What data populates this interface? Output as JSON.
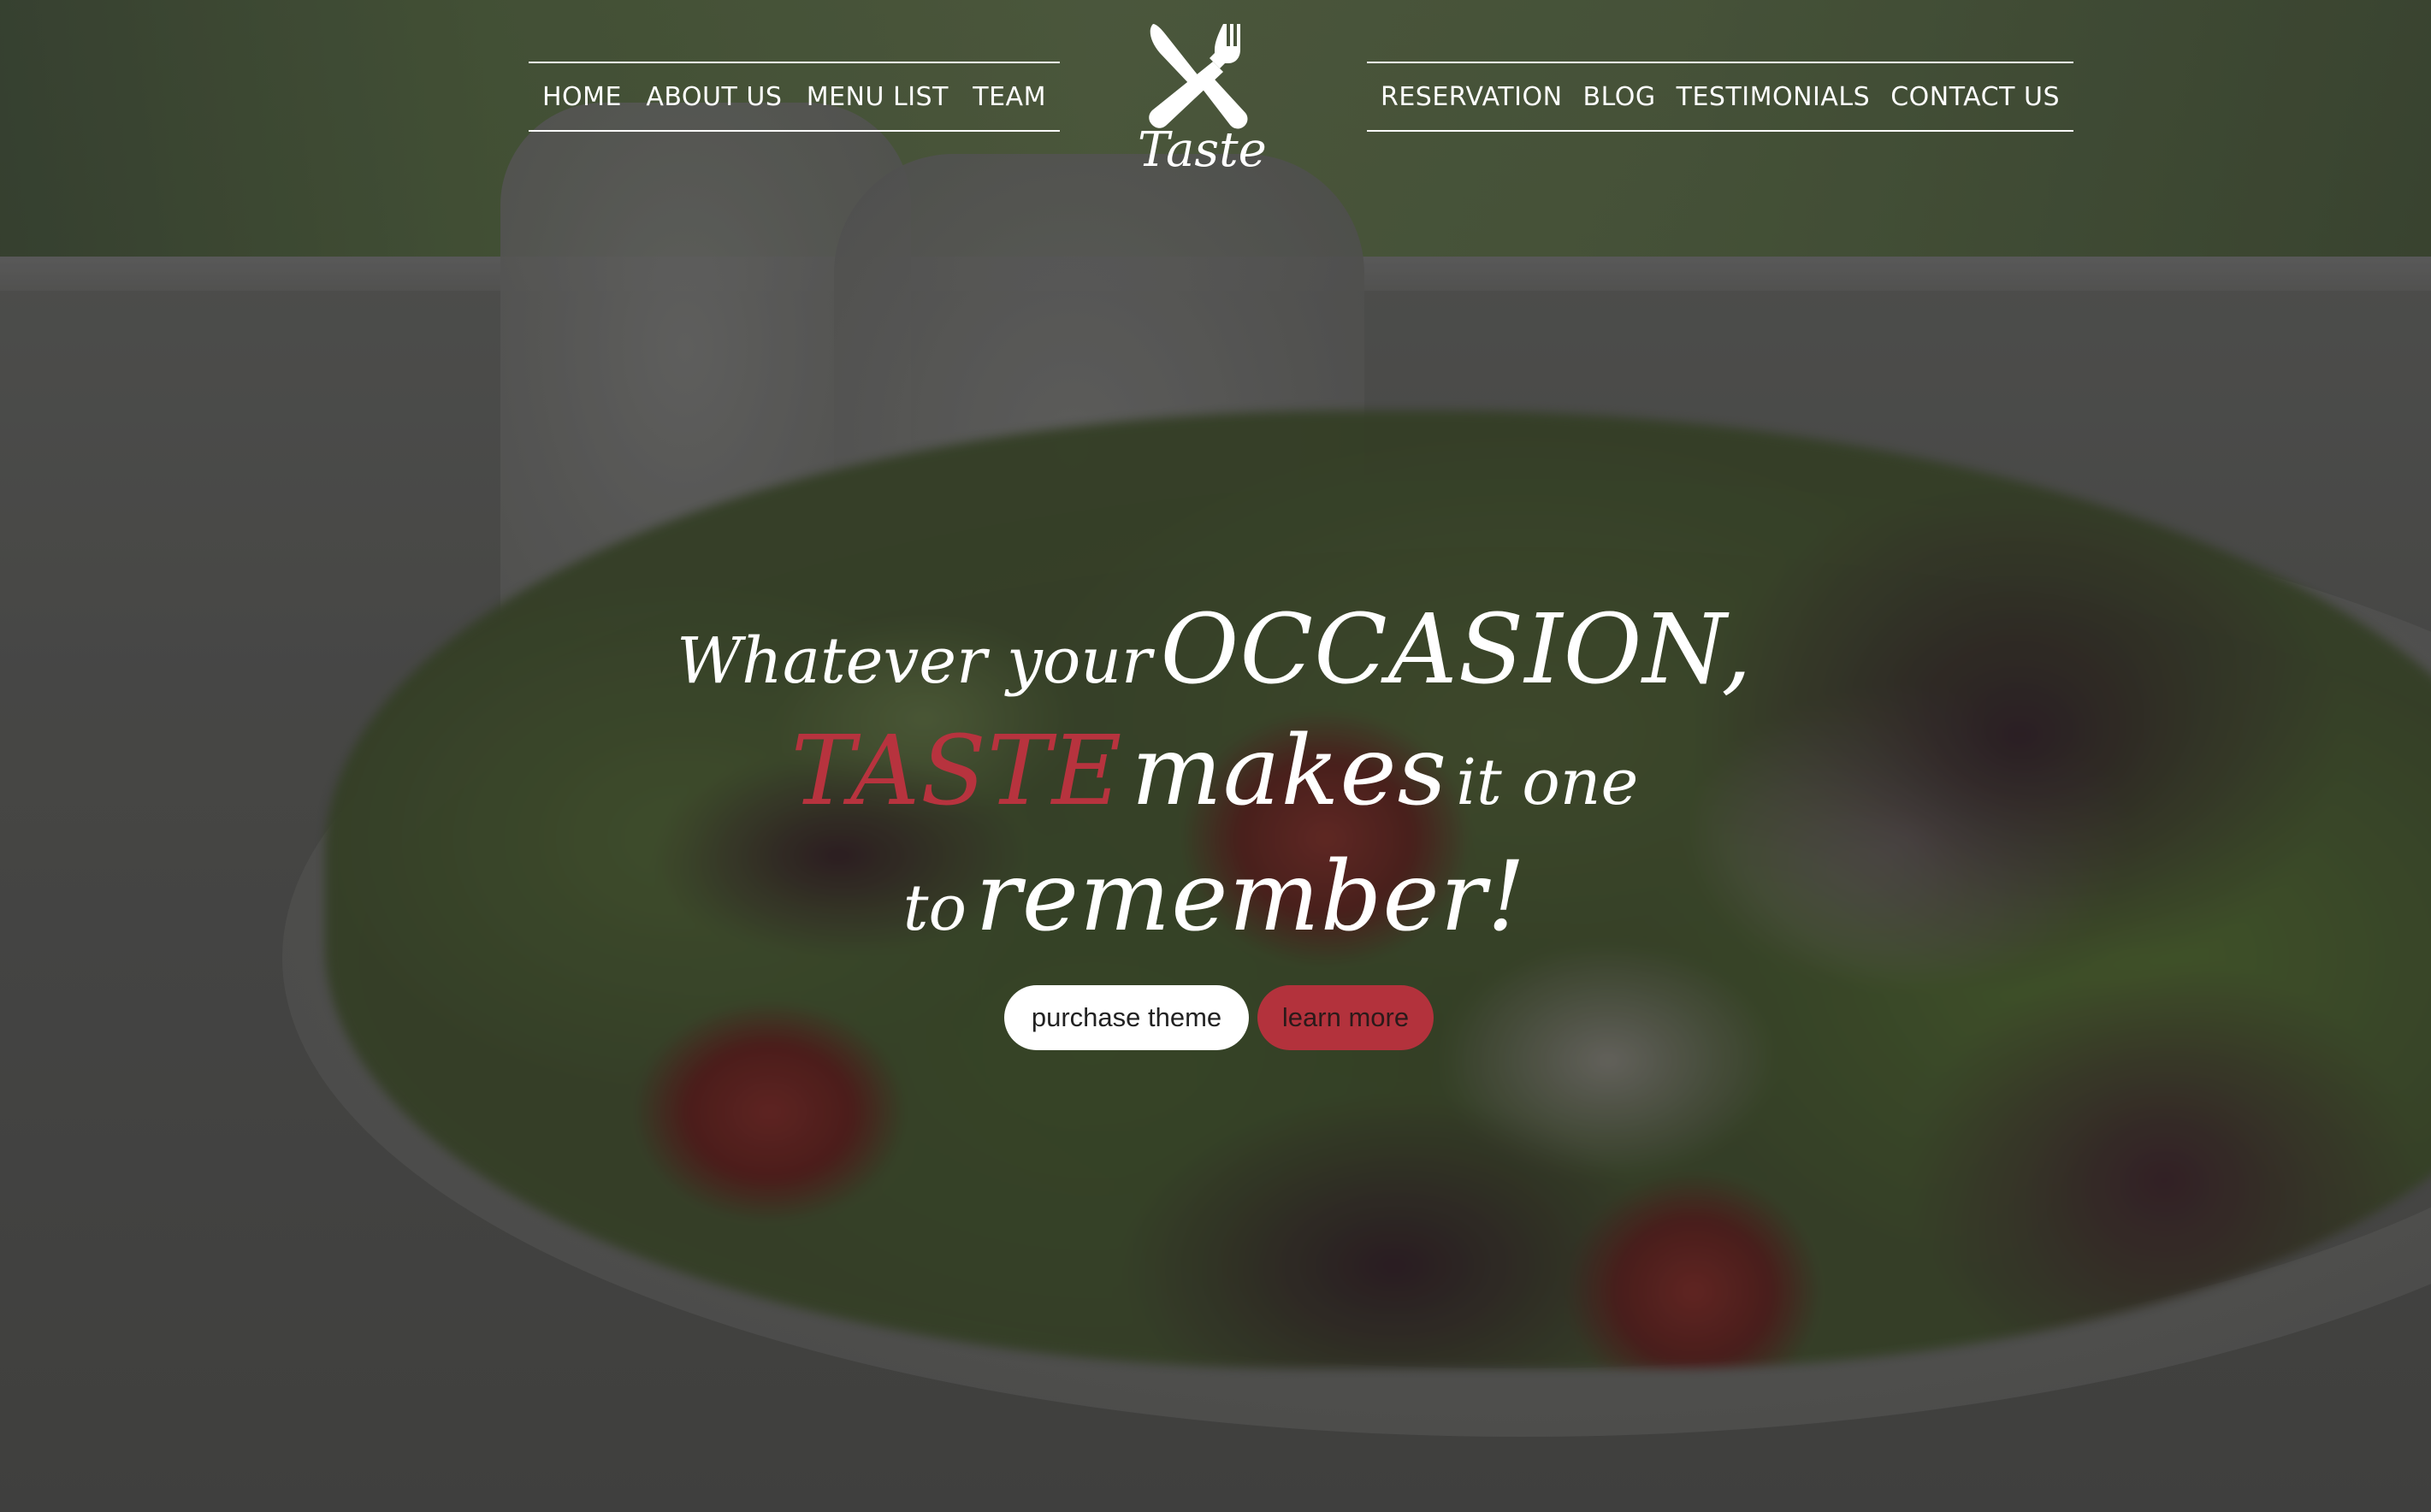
{
  "nav": {
    "left": [
      {
        "label": "HOME"
      },
      {
        "label": "ABOUT US"
      },
      {
        "label": "MENU LIST"
      },
      {
        "label": "TEAM"
      }
    ],
    "right": [
      {
        "label": "RESERVATION"
      },
      {
        "label": "BLOG"
      },
      {
        "label": "TESTIMONIALS"
      },
      {
        "label": "CONTACT US"
      }
    ]
  },
  "logo": {
    "icon": "crossed-knife-fork-icon",
    "text": "Taste"
  },
  "headline": {
    "line1": {
      "part1": "Whatever your",
      "part2": "OCCASION,"
    },
    "line2": {
      "part1": "TASTE",
      "part2": "makes",
      "part3": "it one"
    },
    "line3": {
      "part1": "to",
      "part2": "remember!"
    }
  },
  "buttons": {
    "purchase": "purchase theme",
    "learn": "learn more"
  },
  "colors": {
    "accent": "#b7333e",
    "button_primary_bg": "#ffffff",
    "button_secondary_bg": "#b3323c",
    "nav_text": "#ffffff"
  }
}
